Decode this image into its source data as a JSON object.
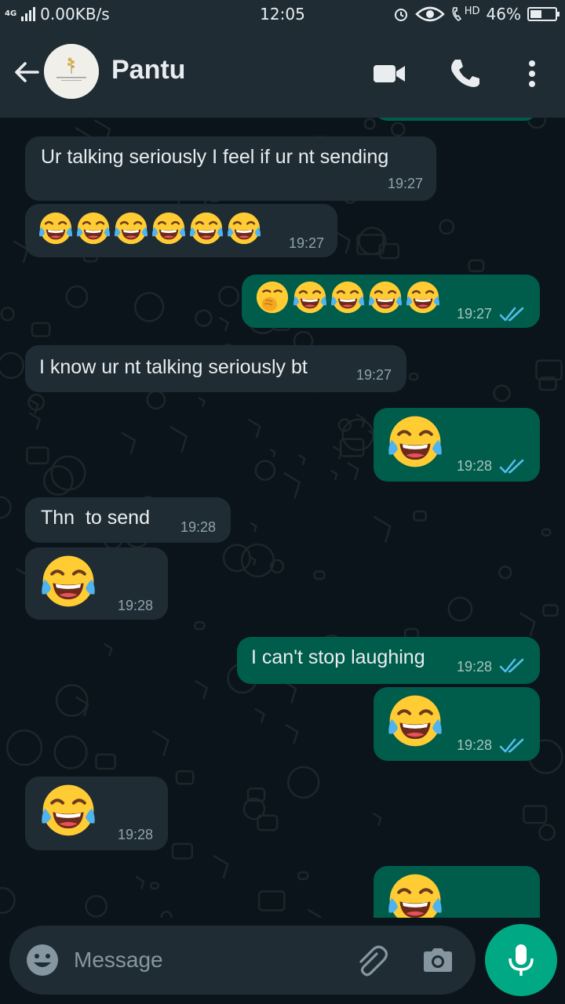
{
  "status_bar": {
    "network": "4G",
    "speed": "0.00KB/s",
    "time": "12:05",
    "hd_label": "HD",
    "battery_percent": "46%",
    "battery_level": 0.46
  },
  "header": {
    "contact_name": "Pantu",
    "icons": [
      "back-arrow-icon",
      "video-call-icon",
      "phone-icon",
      "more-vert-icon"
    ]
  },
  "messages": [
    {
      "dir": "in",
      "text": "Ur talking seriously I feel if ur nt sending",
      "time": "19:27"
    },
    {
      "dir": "in",
      "emoji": "face-with-tears-of-joy x6",
      "time": "19:27"
    },
    {
      "dir": "out",
      "emoji": "face-with-hand-over-mouth + face-with-tears-of-joy x4",
      "time": "19:27",
      "read": true
    },
    {
      "dir": "in",
      "text": "I know ur nt talking seriously bt",
      "time": "19:27"
    },
    {
      "dir": "out",
      "emoji": "face-with-tears-of-joy",
      "time": "19:28",
      "read": true
    },
    {
      "dir": "in",
      "text": "Thn  to send",
      "time": "19:28"
    },
    {
      "dir": "in",
      "emoji": "face-with-tears-of-joy",
      "time": "19:28"
    },
    {
      "dir": "out",
      "text": "I can't stop laughing",
      "time": "19:28",
      "read": true
    },
    {
      "dir": "out",
      "emoji": "face-with-tears-of-joy",
      "time": "19:28",
      "read": true
    },
    {
      "dir": "in",
      "emoji": "face-with-tears-of-joy",
      "time": "19:28"
    },
    {
      "dir": "out",
      "emoji": "face-with-tears-of-joy",
      "time": "",
      "read": true
    }
  ],
  "composer": {
    "placeholder": "Message",
    "icons": [
      "emoji-icon",
      "attach-icon",
      "camera-icon",
      "mic-icon"
    ]
  },
  "colors": {
    "header_bg": "#1f2c34",
    "incoming_bubble": "#1f2c34",
    "outgoing_bubble": "#005c4b",
    "read_ticks": "#53bdeb",
    "accent": "#00a884"
  }
}
